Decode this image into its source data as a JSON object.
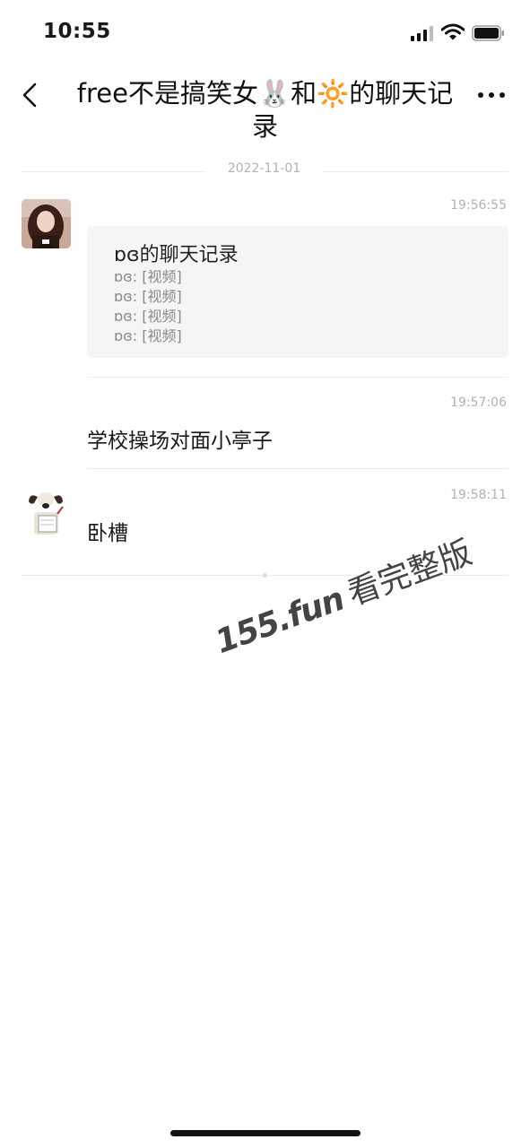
{
  "status_bar": {
    "time": "10:55"
  },
  "nav": {
    "title": "free不是搞笑女🐰和🔆的聊天记录"
  },
  "date_divider": "2022-11-01",
  "messages": [
    {
      "time": "19:56:55",
      "record": {
        "title": "ɒɞ的聊天记录",
        "lines": [
          "ɒɞ: [视频]",
          "ɒɞ: [视频]",
          "ɒɞ: [视频]",
          "ɒɞ: [视频]"
        ]
      }
    },
    {
      "time": "19:57:06",
      "text": "学校操场对面小亭子"
    },
    {
      "time": "19:58:11",
      "text": "卧槽"
    }
  ],
  "watermark": {
    "brand": "155.fun",
    "slogan": "看完整版"
  },
  "colors": {
    "card_bg": "#f5f5f5",
    "meta_text": "#b2b2b2",
    "divider": "#ececec"
  }
}
